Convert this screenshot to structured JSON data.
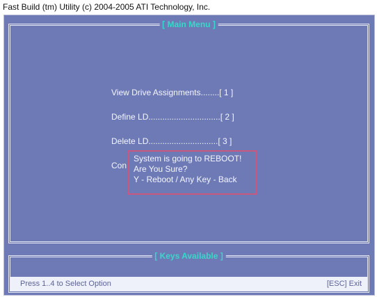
{
  "window": {
    "title": "Fast Build (tm) Utility (c) 2004-2005 ATI Technology, Inc."
  },
  "main_menu": {
    "title": "[ Main Menu ]",
    "items": [
      {
        "label": "View Drive Assignments........[ 1 ]"
      },
      {
        "label": "Define LD...............................[ 2 ]"
      },
      {
        "label": "Delete LD..............................[ 3 ]"
      },
      {
        "label": "Con"
      }
    ]
  },
  "reboot_dialog": {
    "line1": "System is going to REBOOT!",
    "line2": "Are You Sure?",
    "line3": "Y - Reboot / Any Key - Back"
  },
  "keys_panel": {
    "title": "[ Keys Available ]",
    "hint": "Press 1..4 to Select Option",
    "esc_hint": "[ESC] Exit"
  },
  "colors": {
    "background": "#6e7ab6",
    "title_accent": "#39d7c9",
    "popup_border": "#c8587e",
    "text": "#f4f6ff"
  }
}
